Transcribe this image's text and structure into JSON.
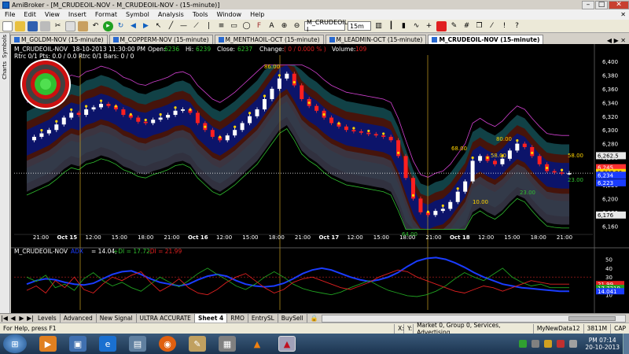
{
  "window": {
    "title": "AmiBroker - [M_CRUDEOIL-NOV - M_CRUDEOIL-NOV - (15-minute)]"
  },
  "menu": [
    "File",
    "Edit",
    "View",
    "Insert",
    "Format",
    "Symbol",
    "Analysis",
    "Tools",
    "Window",
    "Help"
  ],
  "toolbar": {
    "symbol_value": "M_CRUDEOIL-I",
    "interval_value": "15m"
  },
  "sidebar": {
    "labels": [
      "Symbols",
      "Charts"
    ]
  },
  "tabs": [
    "M_GOLDM-NOV (15-minute)",
    "M_COPPERM-NOV (15-minute)",
    "M_MENTHAOIL-OCT (15-minute)",
    "M_LEADMIN-OCT (15-minute)",
    "M_CRUDEOIL-NOV (15-minute)"
  ],
  "chart": {
    "symbol": "M_CRUDEOIL-NOV",
    "datetime": "18-10-2013 11:30:00 PM",
    "open_label": "Open:",
    "open": "6236",
    "hi_label": "Hi:",
    "hi": "6239",
    "close_label": "Close:",
    "close": "6237",
    "change_label": "Change:",
    "change": "( 0 / 0.000 % )",
    "volume_label": "Volume:",
    "volume": "109",
    "line2": "Rtrc 0/1 Pts: 0.0 / 0.0    Rtrc 0/1 Bars: 0 / 0",
    "indicator_title": "M_CRUDEOIL-NOV",
    "adx_text": "= 14.04,",
    "pdi_text": "+DI = 17.72,",
    "mdi_text": "-DI = 21.99"
  },
  "chart_data": {
    "type": "line",
    "price_axis": {
      "ylim": [
        6150,
        6400
      ],
      "ticks": [
        "6,400",
        "6,380",
        "6,360",
        "6,340",
        "6,320",
        "6,300",
        "6,280",
        "6,260",
        "6,240",
        "6,220",
        "6,200",
        "6,180",
        "6,160"
      ],
      "tags": [
        "6,262.5",
        "6,245",
        "6,237.96",
        "6,234",
        "6,223",
        "6,176"
      ]
    },
    "x_tick_labels": [
      "21:00",
      "Oct 15",
      "12:00",
      "15:00",
      "18:00",
      "21:00",
      "Oct 16",
      "12:00",
      "15:00",
      "18:00",
      "21:00",
      "Oct 17",
      "12:00",
      "15:00",
      "18:00",
      "21:00",
      "Oct 18",
      "12:00",
      "15:00",
      "18:00",
      "21:00"
    ],
    "annotations": [
      "86.00",
      "68.00",
      "80.00",
      "58.00",
      "58.00",
      "64.00",
      "10.00",
      "23.00",
      "23.00"
    ],
    "close_series": [
      6285,
      6290,
      6295,
      6300,
      6308,
      6318,
      6325,
      6322,
      6330,
      6333,
      6338,
      6335,
      6330,
      6322,
      6318,
      6312,
      6310,
      6315,
      6318,
      6322,
      6328,
      6330,
      6325,
      6310,
      6300,
      6290,
      6285,
      6292,
      6300,
      6310,
      6320,
      6330,
      6345,
      6360,
      6375,
      6382,
      6365,
      6345,
      6335,
      6328,
      6318,
      6310,
      6305,
      6300,
      6298,
      6296,
      6294,
      6292,
      6290,
      6285,
      6262,
      6230,
      6200,
      6180,
      6176,
      6182,
      6185,
      6195,
      6210,
      6225,
      6255,
      6262,
      6255,
      6250,
      6258,
      6270,
      6280,
      6275,
      6262,
      6250,
      6240,
      6238,
      6237,
      6237
    ],
    "indicator_axis": {
      "ylim": [
        0,
        55
      ],
      "ticks": [
        "50",
        "40",
        "30",
        "20",
        "10"
      ],
      "tags": [
        "21.99",
        "17.7219",
        "14.041"
      ]
    },
    "series": [
      {
        "name": "ADX",
        "color": "#1a3cff",
        "values": [
          22,
          26,
          28,
          27,
          24,
          22,
          21,
          23,
          28,
          33,
          36,
          37,
          33,
          28,
          24,
          22,
          20,
          22,
          27,
          31,
          33,
          31,
          26,
          22,
          20,
          19,
          20,
          23,
          28,
          34,
          38,
          40,
          38,
          34,
          30,
          27,
          25,
          27,
          30,
          35,
          42,
          48,
          51,
          52,
          50,
          46,
          41,
          35,
          30,
          26,
          22,
          20,
          18,
          17,
          16,
          15,
          14,
          14
        ]
      },
      {
        "name": "+DI",
        "color": "#20a020",
        "values": [
          30,
          25,
          32,
          18,
          22,
          15,
          28,
          35,
          26,
          20,
          24,
          18,
          14,
          22,
          30,
          24,
          19,
          26,
          34,
          40,
          33,
          27,
          20,
          16,
          22,
          30,
          36,
          30,
          22,
          17,
          14,
          12,
          10,
          13,
          18,
          22,
          26,
          20,
          15,
          12,
          9,
          8,
          10,
          14,
          20,
          28,
          35,
          30,
          26,
          33,
          40,
          30,
          24,
          20,
          22,
          18,
          18,
          18
        ]
      },
      {
        "name": "-DI",
        "color": "#e02020",
        "values": [
          15,
          20,
          12,
          26,
          18,
          30,
          16,
          12,
          22,
          30,
          26,
          32,
          36,
          24,
          14,
          20,
          28,
          18,
          12,
          10,
          16,
          24,
          30,
          34,
          26,
          18,
          12,
          16,
          24,
          28,
          30,
          26,
          22,
          18,
          16,
          20,
          24,
          30,
          34,
          38,
          36,
          30,
          26,
          22,
          18,
          14,
          12,
          16,
          20,
          18,
          14,
          18,
          22,
          26,
          24,
          22,
          22,
          22
        ]
      }
    ]
  },
  "sheet_tabs": [
    "Levels",
    "Advanced",
    "New Signal",
    "ULTRA ACCURATE",
    "Sheet 4",
    "RMO",
    "EntrySL",
    "BuySell"
  ],
  "status": {
    "help": "For Help, press F1",
    "x_label": "X:",
    "y_label": "Y:",
    "market": "Market 0, Group 0, Services, Advertising",
    "db": "MyNewData12",
    "mem": "3811M",
    "cap": "CAP"
  },
  "clock": {
    "time": "PM 07:14",
    "date": "20-10-2013"
  },
  "colors": {
    "background": "#000000",
    "accent": "#ffd400",
    "bull": "#ffffff",
    "bear": "#ff2020"
  }
}
